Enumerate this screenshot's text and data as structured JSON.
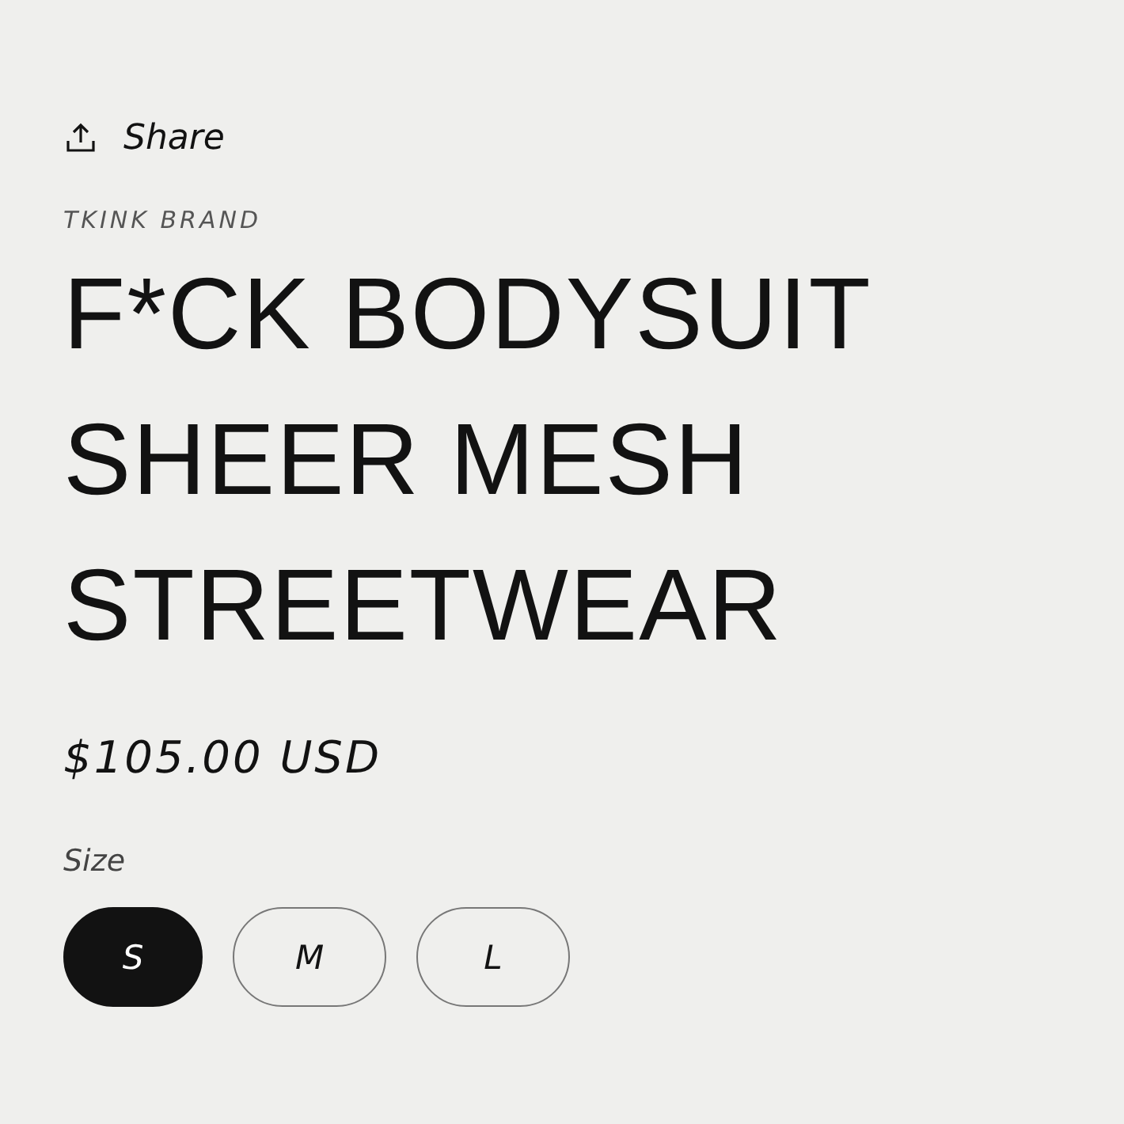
{
  "share": {
    "label": "Share"
  },
  "brand": "TKINK BRAND",
  "title_lines": [
    "F*CK BODYSUIT",
    "SHEER MESH",
    "STREETWEAR"
  ],
  "price": "$105.00 USD",
  "size": {
    "label": "Size",
    "options": [
      {
        "label": "S",
        "selected": true
      },
      {
        "label": "M",
        "selected": false
      },
      {
        "label": "L",
        "selected": false
      }
    ]
  }
}
